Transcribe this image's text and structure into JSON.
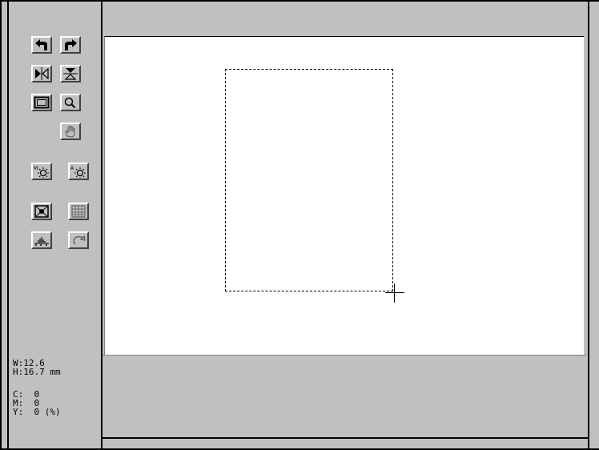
{
  "readout": {
    "width": "W:12.6",
    "height": "H:16.7 mm",
    "cyan": "C:  0",
    "magenta": "M:  0",
    "yellow": "Y:  0 (%)"
  },
  "toolbar": {
    "icons": [
      "rotate-left-icon",
      "rotate-right-icon",
      "flip-horizontal-icon",
      "flip-vertical-icon",
      "frame-icon",
      "zoom-icon",
      "hand-icon",
      "manual-exposure-icon",
      "auto-exposure-icon",
      "color-adjust-icon",
      "grid-adjust-icon",
      "histogram-icon",
      "undo-icon"
    ]
  }
}
